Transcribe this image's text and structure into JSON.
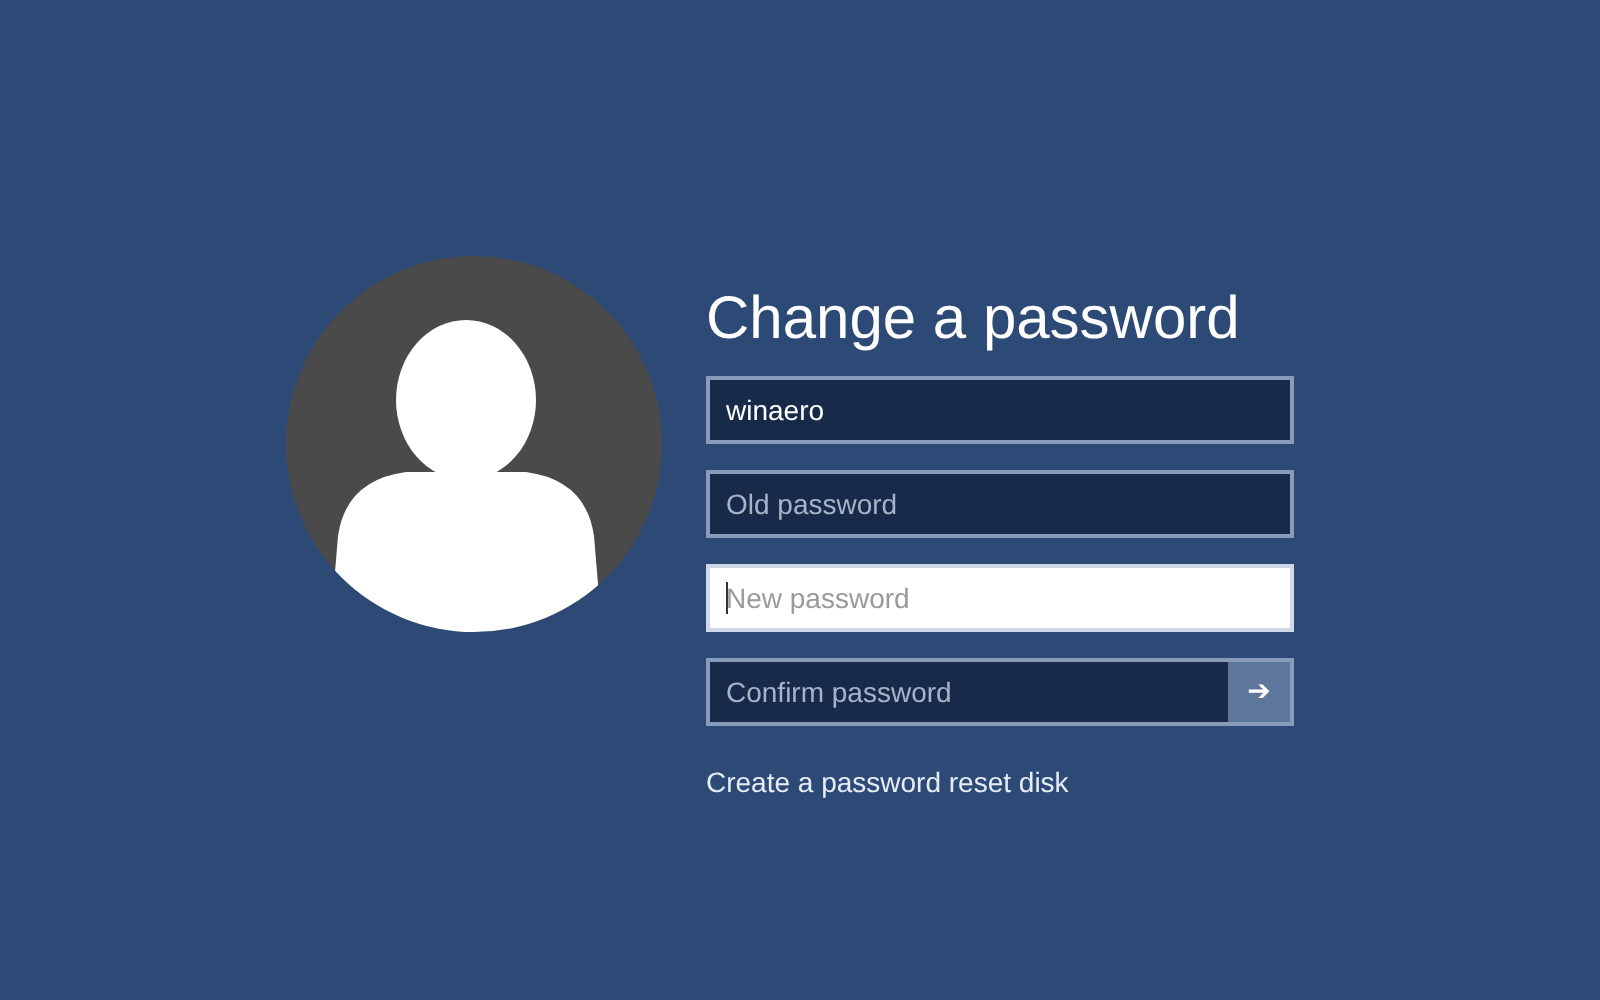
{
  "title": "Change a password",
  "fields": [
    {
      "value": "winaero",
      "focused": false
    },
    {
      "placeholder": "Old password",
      "focused": false
    },
    {
      "placeholder": "New password",
      "focused": true
    },
    {
      "placeholder": "Confirm password",
      "focused": false,
      "submit": "➔"
    }
  ],
  "link": "Create a password reset disk"
}
